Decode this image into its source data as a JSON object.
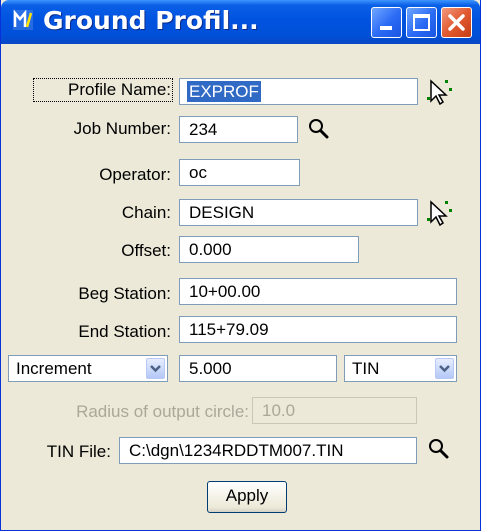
{
  "window": {
    "title": "Ground Profil...",
    "buttons": {
      "minimize_icon": "minimize-icon",
      "maximize_icon": "maximize-icon",
      "close_icon": "close-icon"
    }
  },
  "form": {
    "profile_name": {
      "label": "Profile Name:",
      "value": "EXPROF",
      "icon": "select-element-icon"
    },
    "job_number": {
      "label": "Job Number:",
      "value": "234",
      "icon": "search-icon"
    },
    "operator": {
      "label": "Operator:",
      "value": "oc"
    },
    "chain": {
      "label": "Chain:",
      "value": "DESIGN",
      "icon": "select-element-icon"
    },
    "offset": {
      "label": "Offset:",
      "value": "0.000"
    },
    "beg_station": {
      "label": "Beg Station:",
      "value": "10+00.00"
    },
    "end_station": {
      "label": "End Station:",
      "value": "115+79.09"
    },
    "increment": {
      "mode": "Increment",
      "value": "5.000",
      "source": "TIN"
    },
    "radius": {
      "label": "Radius of output circle:",
      "value": "10.0"
    },
    "tin_file": {
      "label": "TIN File:",
      "value": "C:\\dgn\\1234RDDTM007.TIN",
      "icon": "search-icon"
    },
    "apply_label": "Apply"
  },
  "colors": {
    "titlebar": "#0053e0",
    "selection": "#316ac5",
    "face": "#ece9d8",
    "close": "#e25a30"
  }
}
